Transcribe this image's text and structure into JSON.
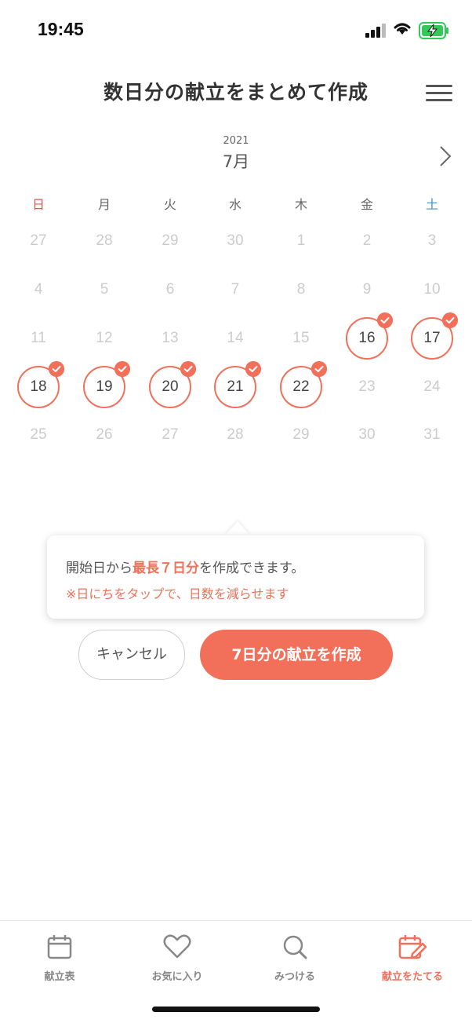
{
  "status": {
    "time": "19:45"
  },
  "header": {
    "title": "数日分の献立をまとめて作成"
  },
  "calendar": {
    "year": "2021",
    "month": "7月",
    "weekdays": [
      "日",
      "月",
      "火",
      "水",
      "木",
      "金",
      "土"
    ],
    "weeks": [
      [
        "27",
        "28",
        "29",
        "30",
        "1",
        "2",
        "3"
      ],
      [
        "4",
        "5",
        "6",
        "7",
        "8",
        "9",
        "10"
      ],
      [
        "11",
        "12",
        "13",
        "14",
        "15",
        "16",
        "17"
      ],
      [
        "18",
        "19",
        "20",
        "21",
        "22",
        "23",
        "24"
      ],
      [
        "25",
        "26",
        "27",
        "28",
        "29",
        "30",
        "31"
      ]
    ],
    "selected": [
      "16",
      "17",
      "18",
      "19",
      "20",
      "21",
      "22"
    ]
  },
  "tooltip": {
    "line1_prefix": "開始日から",
    "line1_highlight": "最長７日分",
    "line1_suffix": "を作成できます。",
    "line2": "※日にちをタップで、日数を減らせます"
  },
  "buttons": {
    "cancel": "キャンセル",
    "create": "7日分の献立を作成"
  },
  "tabs": [
    {
      "label": "献立表",
      "icon": "calendar-icon"
    },
    {
      "label": "お気に入り",
      "icon": "heart-icon"
    },
    {
      "label": "みつける",
      "icon": "search-icon"
    },
    {
      "label": "献立をたてる",
      "icon": "calendar-edit-icon"
    }
  ],
  "colors": {
    "accent": "#f2705a",
    "sunday": "#e0554a",
    "saturday": "#4a8ad0"
  }
}
